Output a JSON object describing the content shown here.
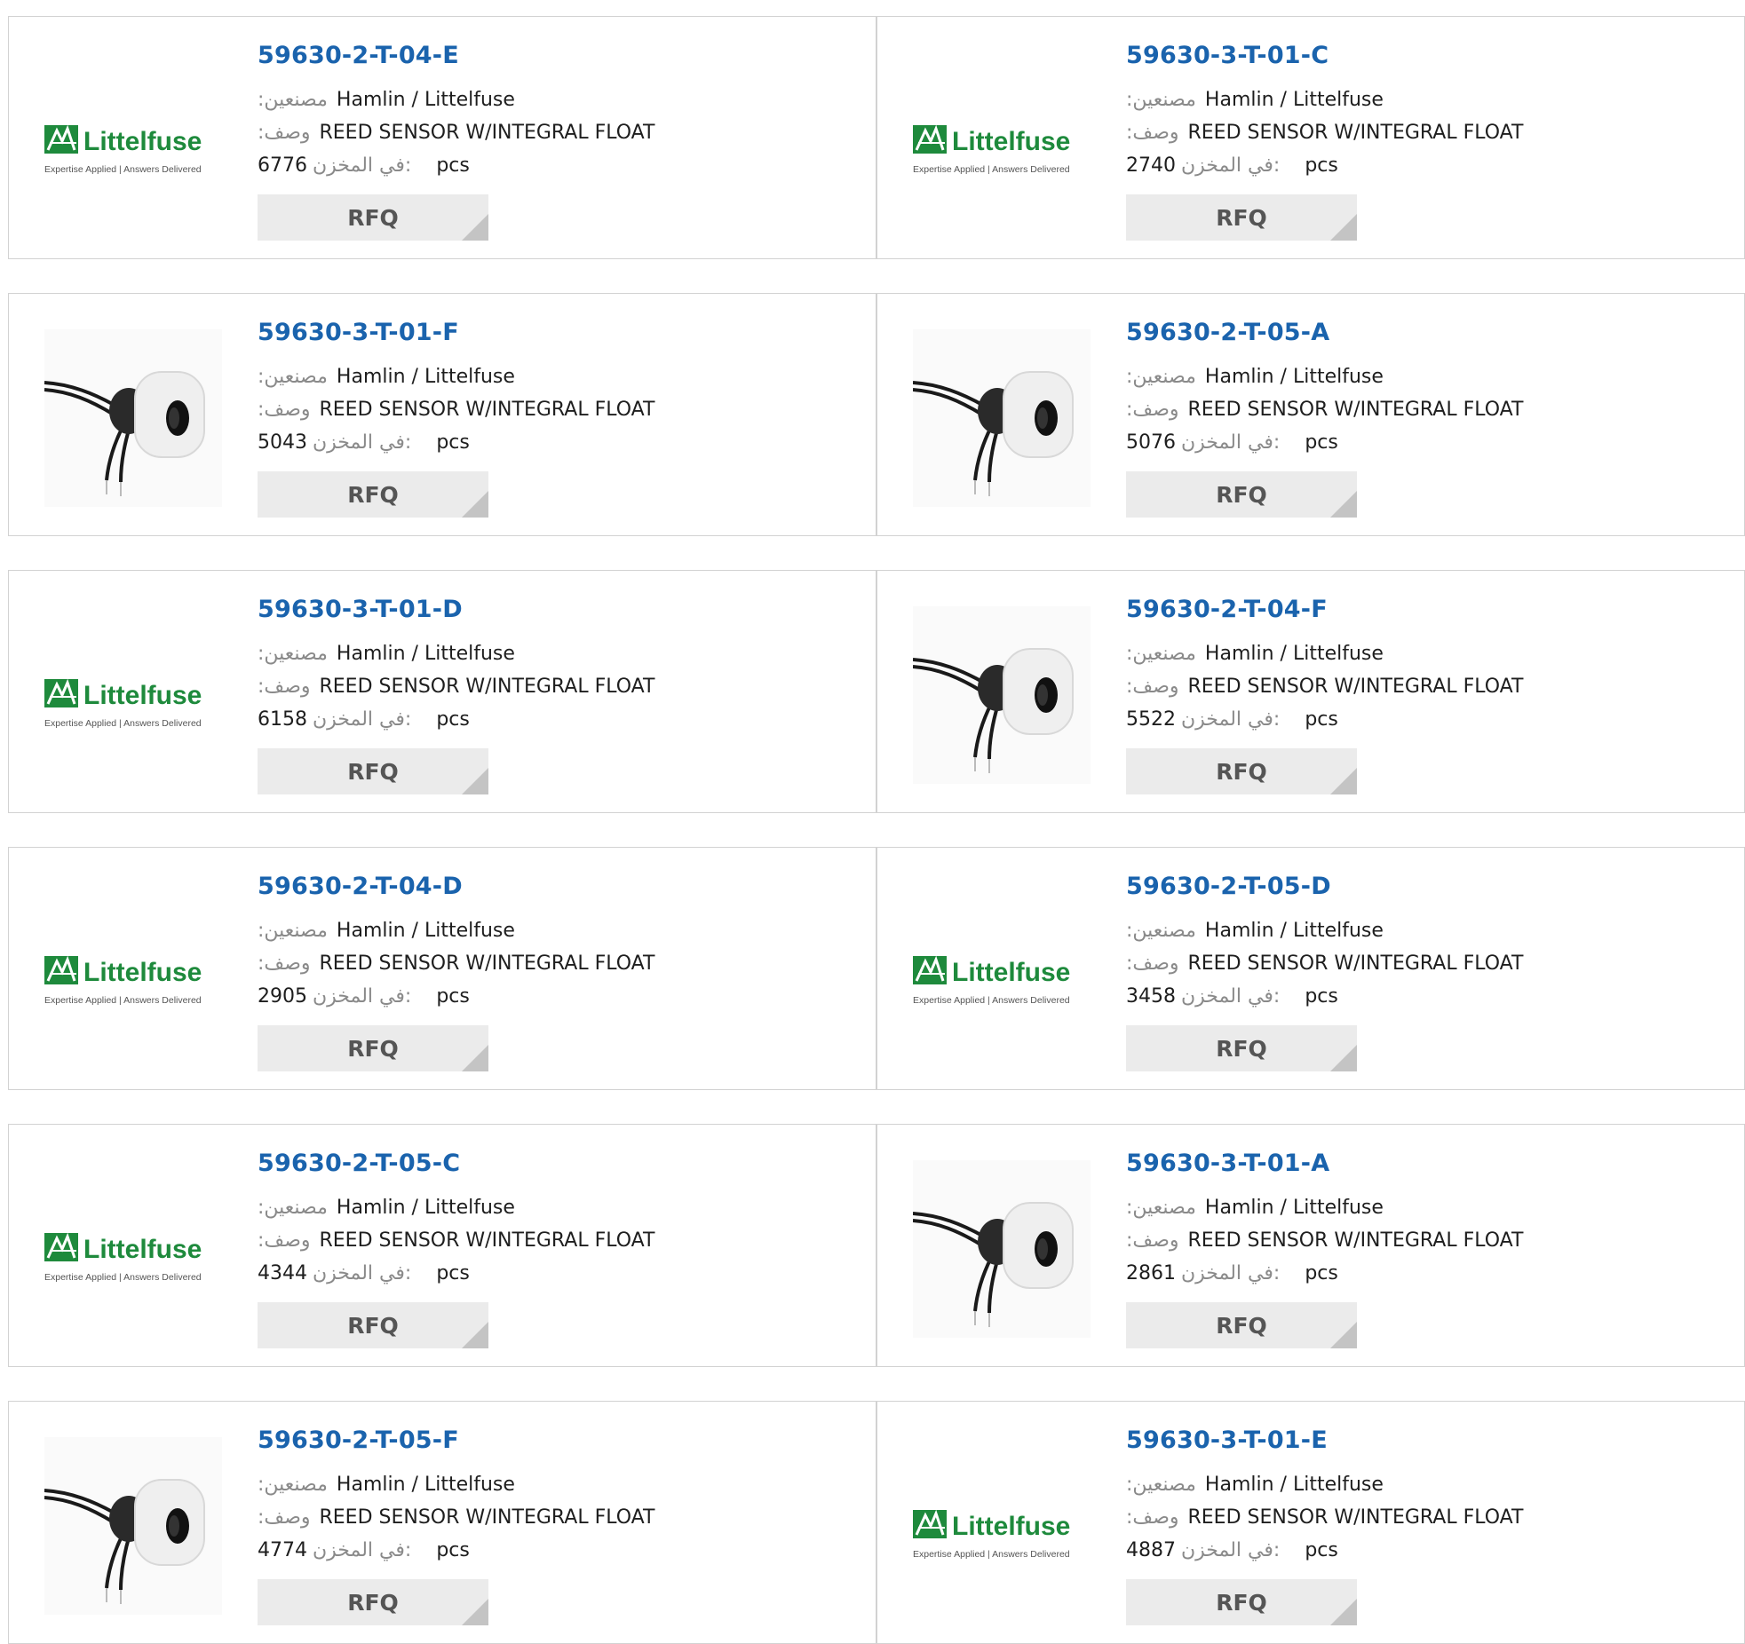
{
  "labels": {
    "manufacturer": ":مصنعين",
    "description": ":وصف",
    "stock": "في المخزن:",
    "unit": "pcs",
    "rfq": "RFQ"
  },
  "logo": {
    "brand": "Littelfuse",
    "tagline": "Expertise Applied | Answers Delivered",
    "brand_color": "#1e8a3c"
  },
  "colors": {
    "title": "#1a63ad",
    "button_bg": "#ebebeb",
    "border": "#d2d2d2"
  },
  "products": [
    {
      "part": "59630-2-T-04-E",
      "manufacturer": "Hamlin / Littelfuse",
      "description": "REED SENSOR W/INTEGRAL FLOAT",
      "stock": "6776",
      "image": "littelfuse-logo"
    },
    {
      "part": "59630-3-T-01-C",
      "manufacturer": "Hamlin / Littelfuse",
      "description": "REED SENSOR W/INTEGRAL FLOAT",
      "stock": "2740",
      "image": "littelfuse-logo"
    },
    {
      "part": "59630-3-T-01-F",
      "manufacturer": "Hamlin / Littelfuse",
      "description": "REED SENSOR W/INTEGRAL FLOAT",
      "stock": "5043",
      "image": "float-sensor"
    },
    {
      "part": "59630-2-T-05-A",
      "manufacturer": "Hamlin / Littelfuse",
      "description": "REED SENSOR W/INTEGRAL FLOAT",
      "stock": "5076",
      "image": "float-sensor"
    },
    {
      "part": "59630-3-T-01-D",
      "manufacturer": "Hamlin / Littelfuse",
      "description": "REED SENSOR W/INTEGRAL FLOAT",
      "stock": "6158",
      "image": "littelfuse-logo"
    },
    {
      "part": "59630-2-T-04-F",
      "manufacturer": "Hamlin / Littelfuse",
      "description": "REED SENSOR W/INTEGRAL FLOAT",
      "stock": "5522",
      "image": "float-sensor"
    },
    {
      "part": "59630-2-T-04-D",
      "manufacturer": "Hamlin / Littelfuse",
      "description": "REED SENSOR W/INTEGRAL FLOAT",
      "stock": "2905",
      "image": "littelfuse-logo"
    },
    {
      "part": "59630-2-T-05-D",
      "manufacturer": "Hamlin / Littelfuse",
      "description": "REED SENSOR W/INTEGRAL FLOAT",
      "stock": "3458",
      "image": "littelfuse-logo"
    },
    {
      "part": "59630-2-T-05-C",
      "manufacturer": "Hamlin / Littelfuse",
      "description": "REED SENSOR W/INTEGRAL FLOAT",
      "stock": "4344",
      "image": "littelfuse-logo"
    },
    {
      "part": "59630-3-T-01-A",
      "manufacturer": "Hamlin / Littelfuse",
      "description": "REED SENSOR W/INTEGRAL FLOAT",
      "stock": "2861",
      "image": "float-sensor"
    },
    {
      "part": "59630-2-T-05-F",
      "manufacturer": "Hamlin / Littelfuse",
      "description": "REED SENSOR W/INTEGRAL FLOAT",
      "stock": "4774",
      "image": "float-sensor"
    },
    {
      "part": "59630-3-T-01-E",
      "manufacturer": "Hamlin / Littelfuse",
      "description": "REED SENSOR W/INTEGRAL FLOAT",
      "stock": "4887",
      "image": "littelfuse-logo"
    }
  ]
}
